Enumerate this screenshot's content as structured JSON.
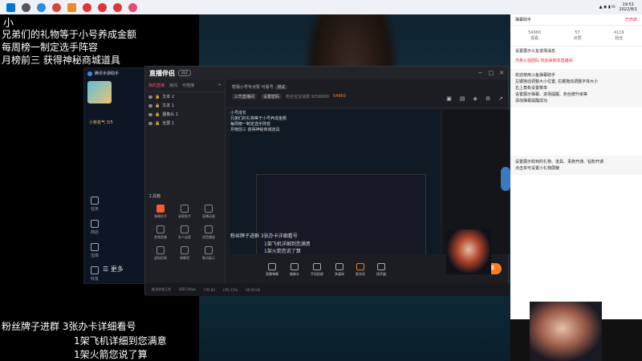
{
  "taskbar": {
    "time": "19:51",
    "date": "2022/8/1"
  },
  "overlay": {
    "logo": "小",
    "lines_top": [
      "兄弟们的礼物等于小号养成金额",
      "每周榜一制定选手阵容",
      "月榜前三 获得神秘商城道具"
    ],
    "lines_bottom": [
      "粉丝牌子进群   3张办卡详细看号",
      "1架飞机详细到您满意",
      "1架火箭您说了算"
    ]
  },
  "left_app": {
    "title": "腾讯手游助手",
    "status": "小有名气 3/5",
    "side_items": [
      "任务",
      "商店",
      "宝库",
      "好友"
    ],
    "bottom_text": "更多"
  },
  "main_window": {
    "logo": "直播伴侣",
    "badge": "测试",
    "tabs": [
      "我的直播",
      "房间",
      "可拖拽"
    ],
    "scenes": [
      "文本 2",
      "文本 1",
      "摄像头 1",
      "全屏 1"
    ],
    "tools_title": "工具箱",
    "tools": [
      "弹幕助手",
      "录屏助手",
      "直播动画",
      "视频直播",
      "多人连麦",
      "语音播放",
      "虚拟形象",
      "弹幕墙",
      "歌词展示",
      "PK",
      "更多"
    ],
    "room_title": "帮我小号专点赞 可看号",
    "room_chip": "测试",
    "room_sub": [
      "公司直播间",
      "设置密码",
      "粉丝宝宝消费 9258000",
      "54960"
    ],
    "preview_overlay": [
      "小号成长",
      "兄弟们的礼物等于小号养成金额",
      "每周榜一制定选手阵容",
      "月榜前三 获得神秘商城道具"
    ],
    "preview_bottom": [
      "粉丝牌子进群   3张办卡详细看号",
      "1架飞机详细到您满意",
      "1架火箭您说了算"
    ],
    "bottom_bar": [
      "直播弹幕",
      "摄像头",
      "手机投屏",
      "多媒体",
      "麦克风",
      "扬声器"
    ],
    "live_button": "开始直播",
    "status": [
      "推流状态正常",
      "码率 0kbps",
      "FPS 60",
      "CPU 15%",
      "00:00:00"
    ]
  },
  "chat_panel": {
    "header_left": "弹幕助手",
    "header_right": "已开启",
    "stats": [
      {
        "value": "54960",
        "label": "观看"
      },
      {
        "value": "57",
        "label": "点赞"
      },
      {
        "value": "4119",
        "label": "粉丝"
      }
    ],
    "messages": [
      "设置展示火友进场消息",
      "杰希火强团队 欢迎来到本直播间",
      "欢迎使用斗鱼弹幕助手",
      "左键拖动调整大小位置, 右键拖动调整字体大小",
      "右上角有设置菜单",
      "设置展示弹幕、进场提醒、粉丝牌升级等",
      "添加弹幕提醒成功",
      "设置展示收到的礼物、道具、贵族开通、钻粉开通",
      "点击单可设置小礼物屏蔽"
    ]
  },
  "colors": {
    "accent": "#ff7a1a",
    "highlight": "#ff4a6a"
  }
}
